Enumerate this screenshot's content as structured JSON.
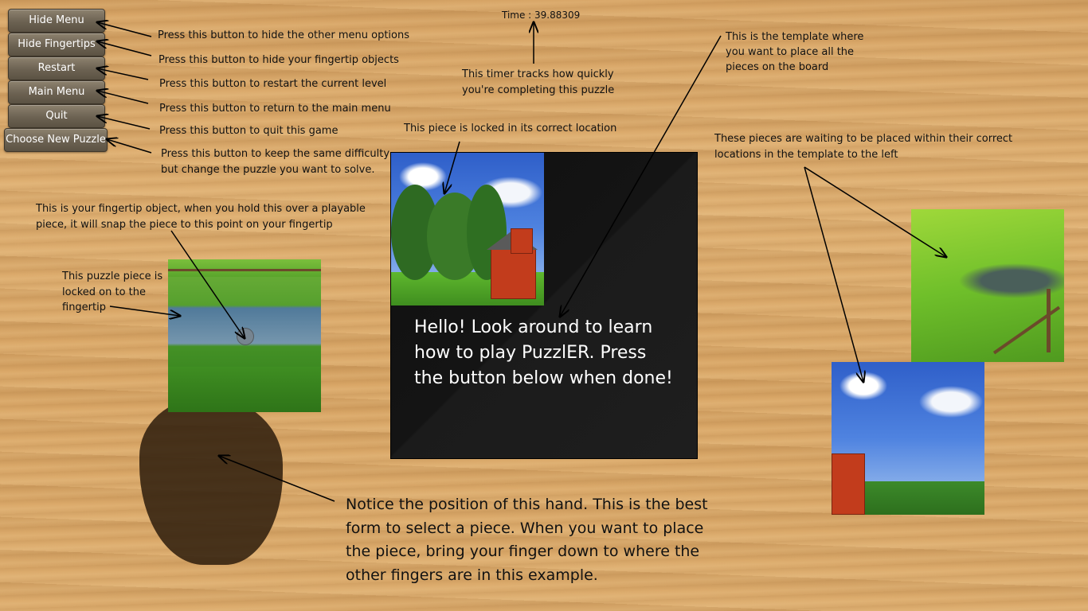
{
  "menu": {
    "hide_menu": "Hide Menu",
    "hide_fingertips": "Hide Fingertips",
    "restart": "Restart",
    "main_menu": "Main Menu",
    "quit": "Quit",
    "choose_new_puzzle": "Choose New Puzzle"
  },
  "annotations": {
    "hide_menu": "Press this button to hide the other menu options",
    "hide_fingertips": "Press this button to hide your fingertip objects",
    "restart": "Press this button to restart the current level",
    "main_menu": "Press this button to return to the main menu",
    "quit": "Press this button to quit this game",
    "choose_new_line1": "Press this button to keep the same difficulty",
    "choose_new_line2": "but change the puzzle you want to solve.",
    "timer_line1": "This timer tracks how quickly",
    "timer_line2": "you're completing this puzzle",
    "locked_piece": "This piece is locked in its correct location",
    "template_line1": "This is the template where",
    "template_line2": "you want to place all the",
    "template_line3": "pieces on the board",
    "waiting_line1": "These pieces are waiting to be placed within their correct",
    "waiting_line2": "locations in the template to the left",
    "fingertip_line1": "This is your fingertip object, when you hold this over a playable",
    "fingertip_line2": "piece, it will snap the piece to this point on your fingertip",
    "locked_on_line1": "This puzzle piece is",
    "locked_on_line2": "locked on to the",
    "locked_on_line3": "fingertip",
    "hand_line1": "Notice the position of this hand. This is the best",
    "hand_line2": "form to select a piece. When you want to place",
    "hand_line3": "the piece, bring your finger down to where the",
    "hand_line4": "other fingers are in this example."
  },
  "timer": {
    "text": "Time : 39.88309"
  },
  "board": {
    "hello_line1": "Hello! Look around to learn",
    "hello_line2": "how to play PuzzlER. Press",
    "hello_line3": "the button below when done!"
  },
  "colors": {
    "button_top": "#8d826f",
    "button_bottom": "#5b5243",
    "board": "#141414",
    "annotation_text": "#111111"
  }
}
